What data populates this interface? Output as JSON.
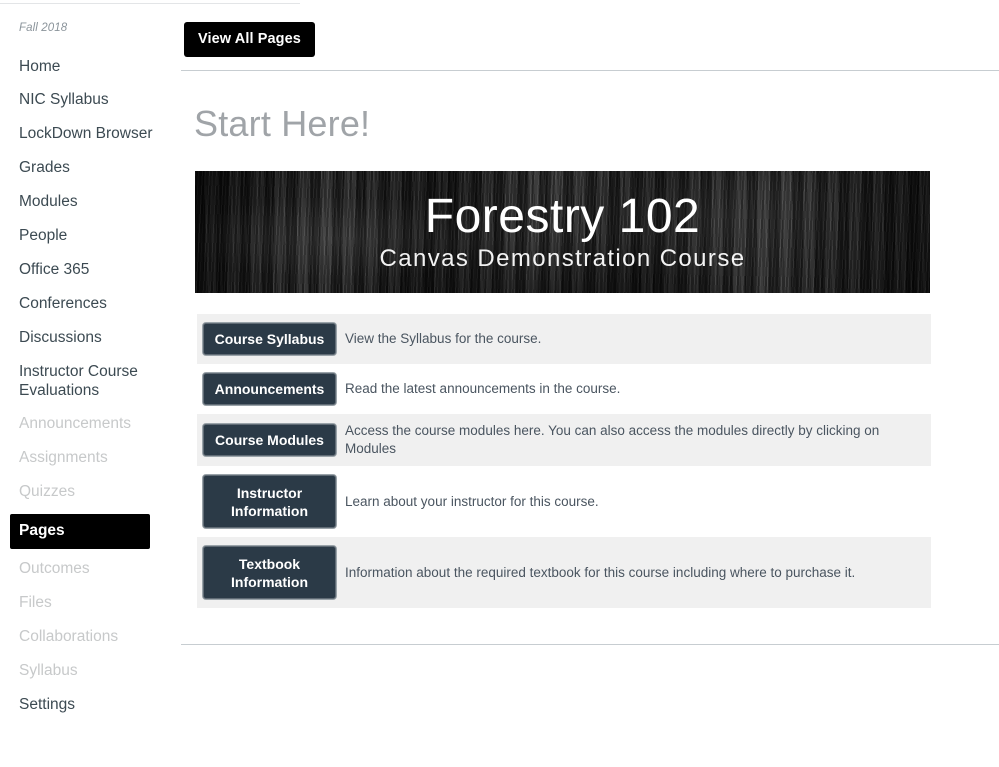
{
  "sidebar": {
    "term_label": "Fall 2018",
    "items": [
      {
        "label": "Home",
        "state": "normal"
      },
      {
        "label": "NIC Syllabus",
        "state": "normal"
      },
      {
        "label": "LockDown Browser",
        "state": "normal"
      },
      {
        "label": "Grades",
        "state": "normal"
      },
      {
        "label": "Modules",
        "state": "normal"
      },
      {
        "label": "People",
        "state": "normal"
      },
      {
        "label": "Office 365",
        "state": "normal"
      },
      {
        "label": "Conferences",
        "state": "normal"
      },
      {
        "label": "Discussions",
        "state": "normal"
      },
      {
        "label": "Instructor Course Evaluations",
        "state": "normal"
      },
      {
        "label": "Announcements",
        "state": "dim"
      },
      {
        "label": "Assignments",
        "state": "dim"
      },
      {
        "label": "Quizzes",
        "state": "dim"
      },
      {
        "label": "Pages",
        "state": "active"
      },
      {
        "label": "Outcomes",
        "state": "dim"
      },
      {
        "label": "Files",
        "state": "dim"
      },
      {
        "label": "Collaborations",
        "state": "dim"
      },
      {
        "label": "Syllabus",
        "state": "dim"
      },
      {
        "label": "Settings",
        "state": "normal"
      }
    ]
  },
  "toolbar": {
    "view_all_pages_label": "View All Pages"
  },
  "page": {
    "title": "Start Here!"
  },
  "banner": {
    "title": "Forestry 102",
    "subtitle": "Canvas Demonstration Course"
  },
  "link_rows": [
    {
      "button_label": "Course Syllabus",
      "description": "View the Syllabus for the course.",
      "striped": true,
      "tall": false
    },
    {
      "button_label": "Announcements",
      "description": "Read the latest announcements in the course.",
      "striped": false,
      "tall": false
    },
    {
      "button_label": "Course Modules",
      "description": "Access the course modules here. You can also access the modules directly by clicking on Modules",
      "striped": true,
      "tall": false
    },
    {
      "button_label": "Instructor Information",
      "description": "Learn about your instructor for this course.",
      "striped": false,
      "tall": true
    },
    {
      "button_label": "Textbook Information",
      "description": "Information about the required textbook for this course including where to purchase it.",
      "striped": true,
      "tall": true
    }
  ],
  "colors": {
    "active_nav_bg": "#000000",
    "link_button_bg": "#2b3a47",
    "stripe_bg": "#f0f0f0",
    "page_title": "#a0a4a8",
    "dim_nav_text": "#c7c9ca"
  }
}
